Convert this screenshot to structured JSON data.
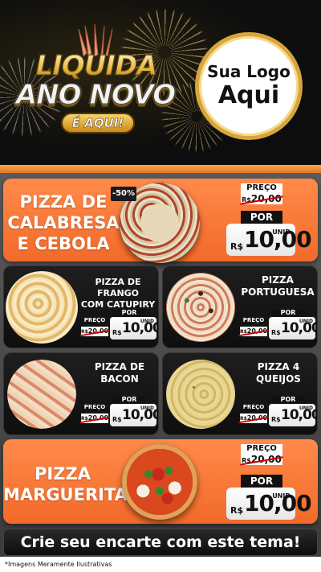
{
  "header": {
    "promo_line1": "LIQUIDA",
    "promo_line2": "ANO NOVO",
    "promo_tag": "É AQUI!",
    "logo_line1": "Sua Logo",
    "logo_line2": "Aqui"
  },
  "featured": [
    {
      "name_line1": "PIZZA DE",
      "name_line2": "CALABRESA",
      "name_line3": "E CEBOLA",
      "discount": "-50%",
      "price_label": "PREÇO",
      "old_currency": "R$",
      "old_price": "20,00",
      "por_label": "POR",
      "currency": "R$",
      "new_price": "10,00",
      "unit": "UNID"
    },
    {
      "name_line1": "PIZZA",
      "name_line2": "MARGUERITA",
      "price_label": "PREÇO",
      "old_currency": "R$",
      "old_price": "20,00",
      "por_label": "POR",
      "currency": "R$",
      "new_price": "10,00",
      "unit": "UNID"
    }
  ],
  "products": [
    {
      "name_line1": "PIZZA DE FRANGO",
      "name_line2": "COM CATUPIRY",
      "price_label": "PREÇO",
      "old_currency": "R$",
      "old_price": "20,00",
      "por_label": "POR",
      "currency": "R$",
      "new_price": "10,00",
      "unit": "UNID"
    },
    {
      "name_line1": "PIZZA",
      "name_line2": "PORTUGUESA",
      "price_label": "PREÇO",
      "old_currency": "R$",
      "old_price": "20,00",
      "por_label": "POR",
      "currency": "R$",
      "new_price": "10,00",
      "unit": "UNID"
    },
    {
      "name_line1": "PIZZA DE",
      "name_line2": "BACON",
      "price_label": "PREÇO",
      "old_currency": "R$",
      "old_price": "20,00",
      "por_label": "POR",
      "currency": "R$",
      "new_price": "10,00",
      "unit": "UNID"
    },
    {
      "name_line1": "PIZZA 4",
      "name_line2": "QUEIJOS",
      "price_label": "PREÇO",
      "old_currency": "R$",
      "old_price": "20,00",
      "por_label": "POR",
      "currency": "R$",
      "new_price": "10,00",
      "unit": "UNID"
    }
  ],
  "footer": {
    "cta": "Crie seu encarte com este tema!",
    "disclaimer": "*Imagens Meramente Ilustrativas"
  },
  "colors": {
    "accent_orange": "#f26a2a",
    "gold": "#d7a53a",
    "dark_card": "#111111"
  }
}
